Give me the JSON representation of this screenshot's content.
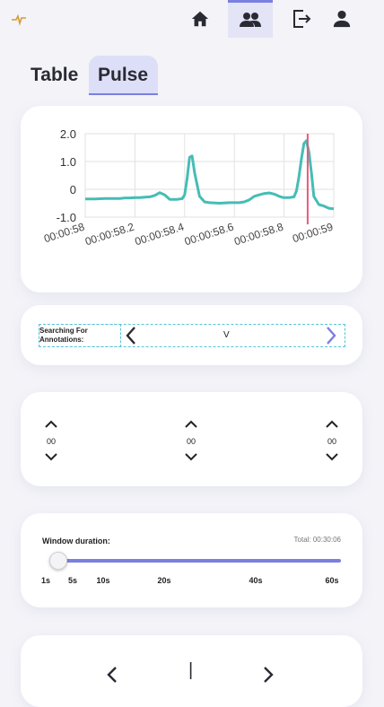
{
  "nav": {
    "items": [
      "home",
      "people",
      "logout",
      "profile"
    ],
    "active": "people"
  },
  "tabs": [
    {
      "label": "Table",
      "active": false
    },
    {
      "label": "Pulse",
      "active": true
    }
  ],
  "chart_data": {
    "type": "line",
    "title": "",
    "xlabel": "",
    "ylabel": "",
    "ylim": [
      -1.0,
      2.0
    ],
    "yticks": [
      "2.0",
      "1.0",
      "0",
      "-1.0"
    ],
    "xticks": [
      "00:00:58",
      "00:00:58.2",
      "00:00:58.4",
      "00:00:58.6",
      "00:00:58.8",
      "00:00:59"
    ],
    "grid": true,
    "series": [
      {
        "color": "#45bdb5",
        "x": [
          58.0,
          58.04,
          58.08,
          58.12,
          58.14,
          58.16,
          58.18,
          58.2,
          58.22,
          58.24,
          58.26,
          58.28,
          58.3,
          58.32,
          58.34,
          58.36,
          58.37,
          58.38,
          58.39,
          58.4,
          58.41,
          58.42,
          58.43,
          58.44,
          58.46,
          58.48,
          58.5,
          58.54,
          58.58,
          58.62,
          58.64,
          58.66,
          58.68,
          58.7,
          58.72,
          58.74,
          58.76,
          58.78,
          58.79,
          58.8,
          58.82,
          58.84,
          58.85,
          58.86,
          58.87,
          58.88,
          58.89,
          58.9,
          58.91,
          58.92,
          58.94,
          58.96,
          58.98,
          59.0
        ],
        "y": [
          -0.35,
          -0.35,
          -0.33,
          -0.33,
          -0.33,
          -0.31,
          -0.31,
          -0.3,
          -0.3,
          -0.28,
          -0.27,
          -0.22,
          -0.12,
          -0.2,
          -0.36,
          -0.36,
          -0.36,
          -0.35,
          -0.34,
          -0.2,
          0.4,
          1.15,
          1.2,
          0.6,
          -0.25,
          -0.45,
          -0.48,
          -0.5,
          -0.48,
          -0.48,
          -0.45,
          -0.38,
          -0.25,
          -0.2,
          -0.15,
          -0.13,
          -0.17,
          -0.25,
          -0.28,
          -0.3,
          -0.3,
          -0.27,
          -0.05,
          0.45,
          1.1,
          1.65,
          1.75,
          1.35,
          0.6,
          -0.25,
          -0.55,
          -0.6,
          -0.68,
          -0.7
        ]
      }
    ],
    "marker_x": 58.895,
    "marker_color": "#e85a7a"
  },
  "annotation_search": {
    "label": "Searching For Annotations:",
    "value": "V"
  },
  "time_steppers": [
    "00",
    "00",
    "00"
  ],
  "window_duration": {
    "label": "Window duration:",
    "total": "Total: 00:30:06",
    "ticks": [
      "1s",
      "5s",
      "10s",
      "20s",
      "40s",
      "60s"
    ],
    "value_index": 0,
    "accent": "#7b7fe0"
  },
  "bottom_nav": {
    "separator": "|"
  }
}
